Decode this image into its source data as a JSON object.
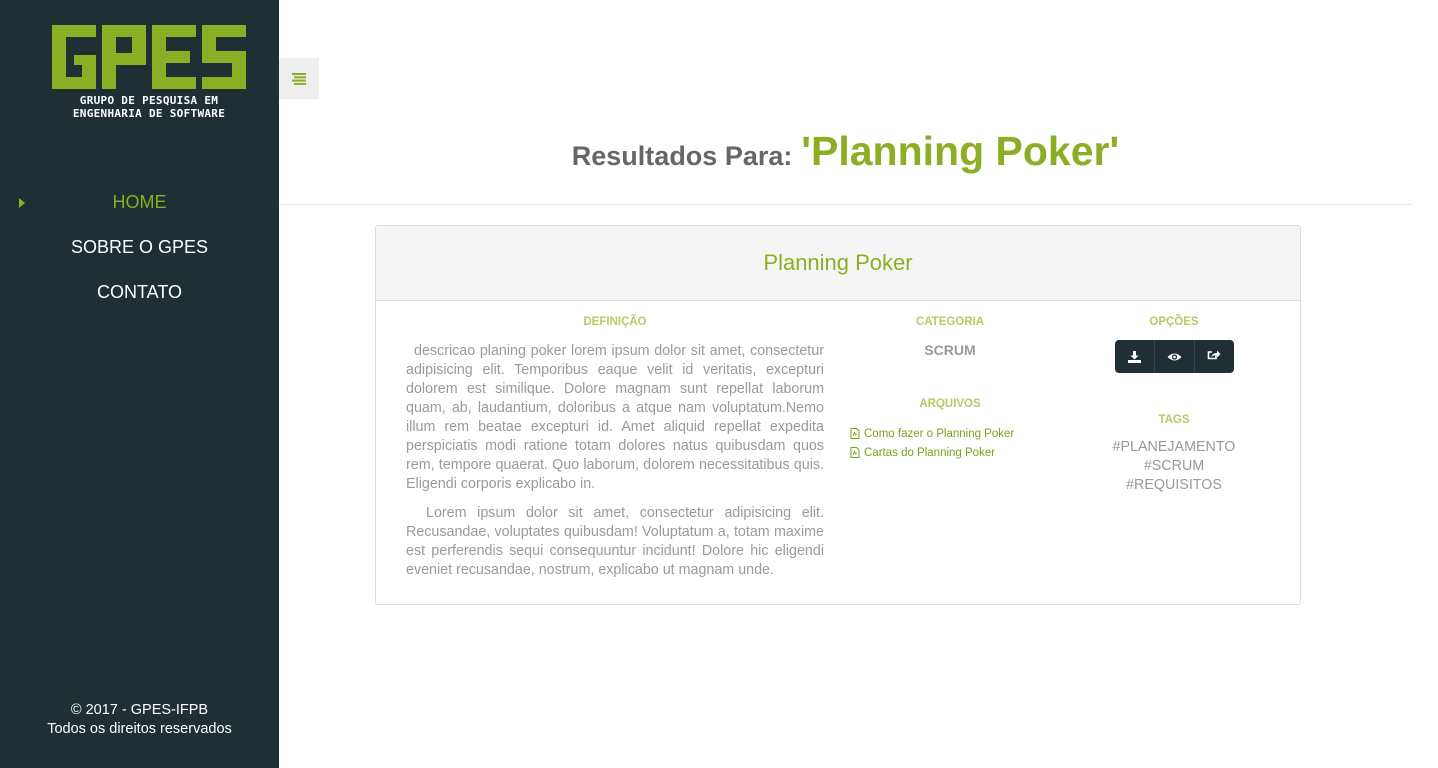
{
  "logo": {
    "mark_text": "GPES",
    "subtitle_line1": "GRUPO DE PESQUISA EM",
    "subtitle_line2": "ENGENHARIA DE SOFTWARE"
  },
  "nav": {
    "items": [
      {
        "label": "HOME",
        "active": true
      },
      {
        "label": "SOBRE O GPES",
        "active": false
      },
      {
        "label": "CONTATO",
        "active": false
      }
    ]
  },
  "footer": {
    "line1": "© 2017 - GPES-IFPB",
    "line2": "Todos os direitos reservados"
  },
  "toggle": {
    "icon": "menu-lines-icon"
  },
  "results": {
    "prefix": "Resultados Para:",
    "query": "'Planning Poker'"
  },
  "card": {
    "title": "Planning Poker",
    "definition": {
      "label": "DEFINIÇÃO",
      "paragraphs": [
        "descricao planing poker lorem ipsum dolor sit amet, consectetur adipisicing elit. Temporibus eaque velit id veritatis, excepturi dolorem est similique. Dolore magnam sunt repellat laborum quam, ab, laudantium, doloribus a atque nam voluptatum.Nemo illum rem beatae excepturi id. Amet aliquid repellat expedita perspiciatis modi ratione totam dolores natus quibusdam quos rem, tempore quaerat. Quo laborum, dolorem necessitatibus quis. Eligendi corporis explicabo in.",
        "Lorem ipsum dolor sit amet, consectetur adipisicing elit. Recusandae, voluptates quibusdam! Voluptatum a, totam maxime est perferendis sequi consequuntur incidunt! Dolore hic eligendi eveniet recusandae, nostrum, explicabo ut magnam unde."
      ]
    },
    "category": {
      "label": "CATEGORIA",
      "value": "SCRUM"
    },
    "files": {
      "label": "ARQUIVOS",
      "items": [
        "Como fazer o Planning Poker",
        "Cartas do Planning Poker"
      ]
    },
    "options": {
      "label": "OPÇÕES",
      "buttons": [
        "download-icon",
        "eye-icon",
        "share-icon"
      ]
    },
    "tags": {
      "label": "TAGS",
      "items": [
        "#PLANEJAMENTO",
        "#SCRUM",
        "#REQUISITOS"
      ]
    }
  },
  "colors": {
    "accent": "#8bae24",
    "sidebar_bg": "#1f2f33",
    "muted_text": "#9a9a9a"
  }
}
